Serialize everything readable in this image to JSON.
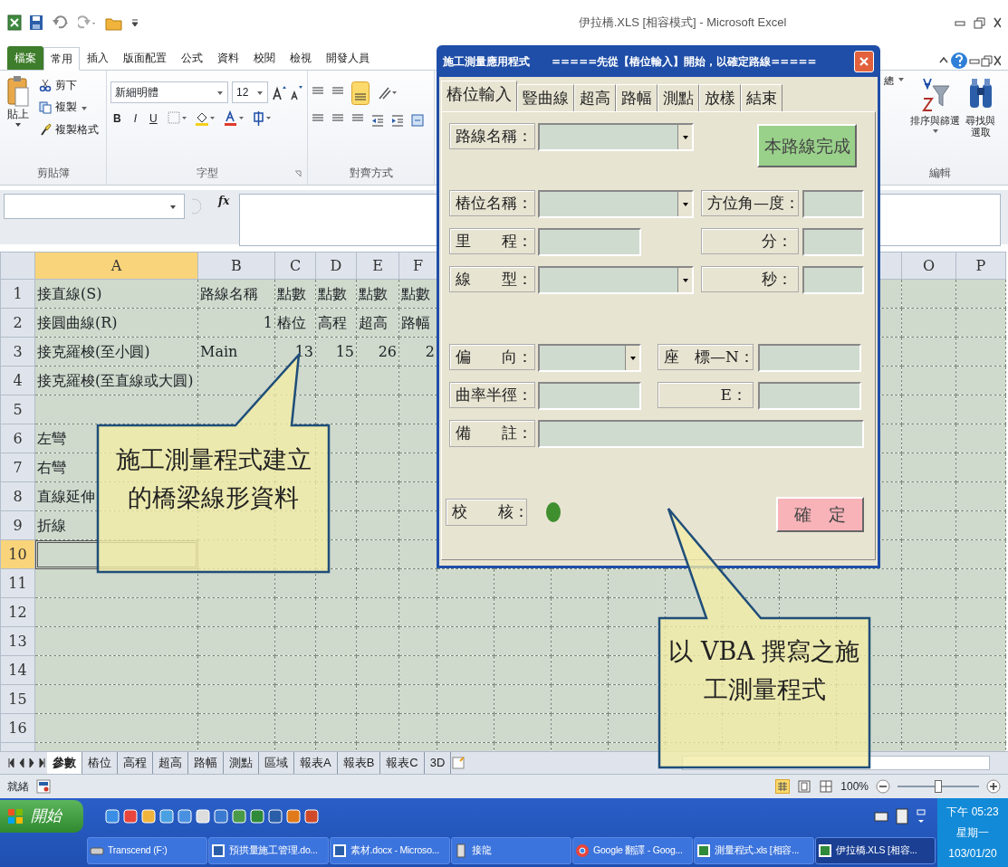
{
  "window": {
    "title": "伊拉橋.XLS  [相容模式] - Microsoft Excel"
  },
  "ribbon": {
    "tabs": [
      {
        "label": "檔案",
        "kind": "file",
        "selected": false
      },
      {
        "label": "常用",
        "kind": "tab",
        "selected": true
      },
      {
        "label": "插入",
        "kind": "tab",
        "selected": false
      },
      {
        "label": "版面配置",
        "kind": "tab",
        "selected": false
      },
      {
        "label": "公式",
        "kind": "tab",
        "selected": false
      },
      {
        "label": "資料",
        "kind": "tab",
        "selected": false
      },
      {
        "label": "校閱",
        "kind": "tab",
        "selected": false
      },
      {
        "label": "檢視",
        "kind": "tab",
        "selected": false
      },
      {
        "label": "開發人員",
        "kind": "tab",
        "selected": false
      }
    ],
    "clipboard": {
      "paste": "貼上",
      "cut": "剪下",
      "copy": "複製",
      "format_painter": "複製格式",
      "label": "剪貼簿"
    },
    "font": {
      "name": "新細明體",
      "size": "12",
      "bold": "B",
      "italic": "I",
      "underline": "U",
      "label": "字型"
    },
    "alignment": {
      "label": "對齊方式"
    },
    "editing": {
      "autosum": "總",
      "sort": "排序與篩選",
      "find_lines": [
        "尋找與",
        "選取"
      ],
      "label": "編輯"
    }
  },
  "formula_bar": {
    "function_label": "fx"
  },
  "sheet": {
    "columns_left": [
      {
        "label": "A",
        "selected": true
      },
      {
        "label": "B",
        "selected": false
      },
      {
        "label": "C",
        "selected": false
      },
      {
        "label": "D",
        "selected": false
      },
      {
        "label": "E",
        "selected": false
      },
      {
        "label": "F",
        "selected": false
      }
    ],
    "columns_right": [
      {
        "label": "O",
        "selected": false
      },
      {
        "label": "P",
        "selected": false
      }
    ],
    "rows": [
      {
        "number": "1",
        "selected": false,
        "cells": [
          {
            "text": "接直線(S)",
            "kind": "text"
          },
          {
            "text": "路線名稱",
            "kind": "text"
          },
          {
            "text": "點數",
            "kind": "text"
          },
          {
            "text": "點數",
            "kind": "text"
          },
          {
            "text": "點數",
            "kind": "text"
          },
          {
            "text": "點數",
            "kind": "text"
          }
        ]
      },
      {
        "number": "2",
        "selected": false,
        "cells": [
          {
            "text": "接圓曲線(R)",
            "kind": "text"
          },
          {
            "text": "1",
            "kind": "number"
          },
          {
            "text": "樁位",
            "kind": "text"
          },
          {
            "text": "高程",
            "kind": "text"
          },
          {
            "text": "超高",
            "kind": "text"
          },
          {
            "text": "路幅",
            "kind": "text"
          }
        ]
      },
      {
        "number": "3",
        "selected": false,
        "cells": [
          {
            "text": "接克羅梭(至小圓)",
            "kind": "text"
          },
          {
            "text": "Main",
            "kind": "text"
          },
          {
            "text": "13",
            "kind": "number"
          },
          {
            "text": "15",
            "kind": "number"
          },
          {
            "text": "26",
            "kind": "number"
          },
          {
            "text": "2",
            "kind": "number"
          }
        ]
      },
      {
        "number": "4",
        "selected": false,
        "cells": [
          {
            "text": "接克羅梭(至直線或大圓)",
            "kind": "text"
          }
        ]
      },
      {
        "number": "5",
        "selected": false,
        "cells": []
      },
      {
        "number": "6",
        "selected": false,
        "cells": [
          {
            "text": "左彎",
            "kind": "text"
          }
        ]
      },
      {
        "number": "7",
        "selected": false,
        "cells": [
          {
            "text": "右彎",
            "kind": "text"
          }
        ]
      },
      {
        "number": "8",
        "selected": false,
        "cells": [
          {
            "text": "直線延伸",
            "kind": "text"
          }
        ]
      },
      {
        "number": "9",
        "selected": false,
        "cells": [
          {
            "text": "折線",
            "kind": "text"
          }
        ]
      },
      {
        "number": "10",
        "selected": true,
        "cells": []
      },
      {
        "number": "11",
        "selected": false,
        "cells": []
      },
      {
        "number": "12",
        "selected": false,
        "cells": []
      },
      {
        "number": "13",
        "selected": false,
        "cells": []
      },
      {
        "number": "14",
        "selected": false,
        "cells": []
      },
      {
        "number": "15",
        "selected": false,
        "cells": []
      },
      {
        "number": "16",
        "selected": false,
        "cells": []
      }
    ]
  },
  "sheet_tabs": [
    {
      "label": "參數",
      "selected": true
    },
    {
      "label": "樁位",
      "selected": false
    },
    {
      "label": "高程",
      "selected": false
    },
    {
      "label": "超高",
      "selected": false
    },
    {
      "label": "路幅",
      "selected": false
    },
    {
      "label": "測點",
      "selected": false
    },
    {
      "label": "區域",
      "selected": false
    },
    {
      "label": "報表A",
      "selected": false
    },
    {
      "label": "報表B",
      "selected": false
    },
    {
      "label": "報表C",
      "selected": false
    },
    {
      "label": "3D",
      "selected": false
    }
  ],
  "status_bar": {
    "text": "就緒",
    "zoom": "100%",
    "zoom_slider": {
      "level": 0.5
    }
  },
  "taskbar": {
    "start": "開始",
    "tasks": [
      {
        "label": "Transcend (F:)",
        "kind": "drive",
        "selected": false
      },
      {
        "label": "預拱量施工管理.do...",
        "kind": "word",
        "selected": false
      },
      {
        "label": "素材.docx - Microso...",
        "kind": "word",
        "selected": false
      },
      {
        "label": "接龍",
        "kind": "file",
        "selected": false
      },
      {
        "label": "Google 翻譯 - Goog...",
        "kind": "chrome",
        "selected": false
      },
      {
        "label": "測量程式.xls [相容...",
        "kind": "excel",
        "selected": false
      },
      {
        "label": "伊拉橋.XLS [相容...",
        "kind": "excel",
        "selected": true
      }
    ],
    "clock": {
      "time": "下午 05:23",
      "day": "星期一",
      "date": "103/01/20"
    }
  },
  "dialog": {
    "title": "施工測量應用程式",
    "banner": "=====先從【樁位輸入】開始，以確定路線=====",
    "tabs": [
      {
        "label": "樁位輸入",
        "selected": true
      },
      {
        "label": "豎曲線",
        "selected": false
      },
      {
        "label": "超高",
        "selected": false
      },
      {
        "label": "路幅",
        "selected": false
      },
      {
        "label": "測點",
        "selected": false
      },
      {
        "label": "放樣",
        "selected": false
      },
      {
        "label": "結束",
        "selected": false
      }
    ],
    "controls": [
      {
        "kind": "label",
        "text": "路線名稱："
      },
      {
        "kind": "combo"
      },
      {
        "kind": "button",
        "text": "本路線完成",
        "color": "#99d08a"
      },
      {
        "kind": "label",
        "text": "樁位名稱："
      },
      {
        "kind": "combo"
      },
      {
        "kind": "label",
        "text": "方位角—度："
      },
      {
        "kind": "field"
      },
      {
        "kind": "label",
        "text": "里　　程："
      },
      {
        "kind": "field"
      },
      {
        "kind": "label",
        "text": "分："
      },
      {
        "kind": "field"
      },
      {
        "kind": "label",
        "text": "線　　型："
      },
      {
        "kind": "combo"
      },
      {
        "kind": "label",
        "text": "秒："
      },
      {
        "kind": "field"
      },
      {
        "kind": "label",
        "text": "偏　　向："
      },
      {
        "kind": "combo"
      },
      {
        "kind": "label",
        "text": "座　標—N："
      },
      {
        "kind": "field"
      },
      {
        "kind": "label",
        "text": "曲率半徑："
      },
      {
        "kind": "field"
      },
      {
        "kind": "label",
        "text": "E："
      },
      {
        "kind": "field"
      },
      {
        "kind": "label",
        "text": "備　　註："
      },
      {
        "kind": "field"
      },
      {
        "kind": "label",
        "text": "校　　核："
      },
      {
        "kind": "indicator",
        "color": "#3f8f2f"
      },
      {
        "kind": "button",
        "text": "確　定",
        "color": "#f7b3b8"
      }
    ]
  },
  "callouts": [
    {
      "lines": [
        "施工測量程式建立",
        "的橋梁線形資料"
      ]
    },
    {
      "lines": [
        "以 VBA 撰寫之施",
        "工測量程式"
      ]
    }
  ]
}
